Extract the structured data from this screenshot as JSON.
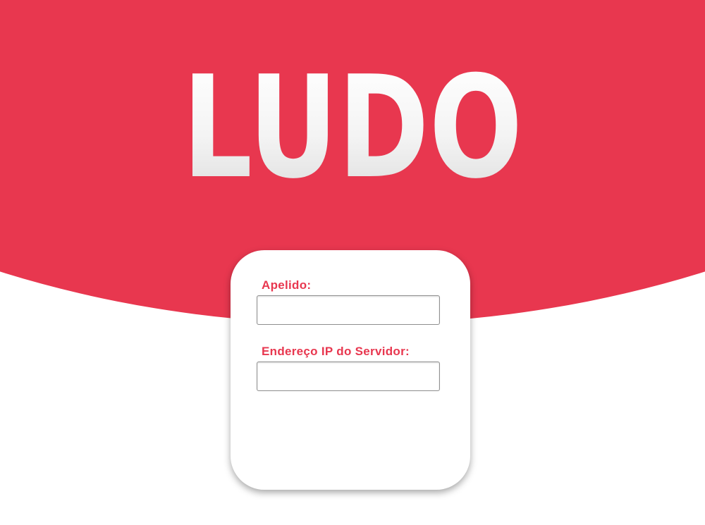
{
  "logo": {
    "text": "LUDO"
  },
  "form": {
    "nickname": {
      "label": "Apelido:",
      "value": "",
      "placeholder": ""
    },
    "server_ip": {
      "label": "Endereço IP do Servidor:",
      "value": "",
      "placeholder": ""
    }
  },
  "colors": {
    "accent": "#e8374f",
    "background": "#ffffff",
    "card": "#ffffff"
  }
}
